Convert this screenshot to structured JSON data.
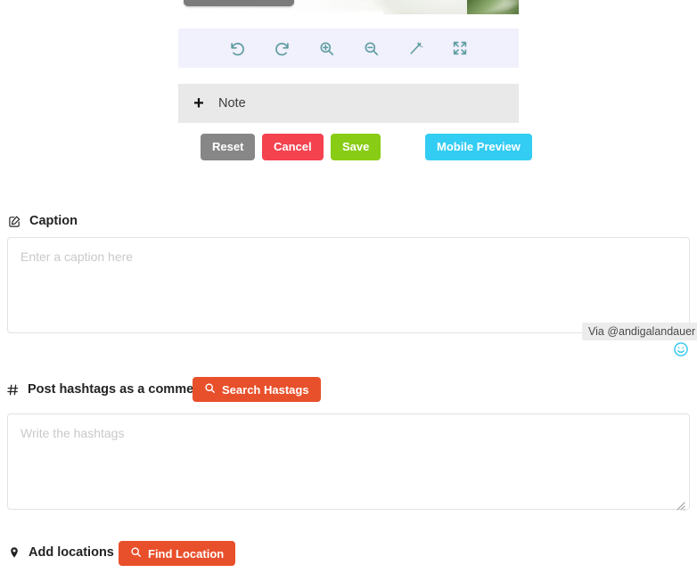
{
  "editor": {
    "image": {
      "alt_name": "cropped-photo-preview",
      "crop_handle": "crop-handle"
    },
    "toolbar": {
      "tools": [
        {
          "name": "undo-icon",
          "label": "Undo"
        },
        {
          "name": "redo-icon",
          "label": "Redo"
        },
        {
          "name": "zoom-in-icon",
          "label": "Zoom In"
        },
        {
          "name": "zoom-out-icon",
          "label": "Zoom Out"
        },
        {
          "name": "magic-wand-icon",
          "label": "Enhance"
        },
        {
          "name": "expand-icon",
          "label": "Fullscreen"
        }
      ],
      "accent_color": "#5f9ea0",
      "background_color": "#f1f0fd"
    },
    "note": {
      "label": "Note",
      "plus": "+"
    },
    "actions": {
      "reset_label": "Reset",
      "cancel_label": "Cancel",
      "save_label": "Save",
      "mobile_preview_label": "Mobile Preview",
      "reset_color": "#878787",
      "cancel_color": "#f4424f",
      "save_color": "#88cc15",
      "preview_color": "#33ccf2"
    }
  },
  "caption": {
    "label": "Caption",
    "icon": "edit-square-icon",
    "value": "",
    "placeholder": "Enter a caption here",
    "via_badge": "Via @andigalandauer",
    "emoji_icon": "smiley-icon",
    "emoji_color": "#35c7ef"
  },
  "hashtags": {
    "label": "Post hashtags as a comment",
    "icon": "hashtag-icon",
    "search_button_label": "Search Hastags",
    "search_button_icon": "search-icon",
    "value": "",
    "placeholder": "Write the hashtags",
    "button_color": "#e8502b"
  },
  "location": {
    "label": "Add locations",
    "icon": "map-pin-icon",
    "find_button_label": "Find Location",
    "find_button_icon": "search-icon",
    "button_color": "#e8502b"
  }
}
